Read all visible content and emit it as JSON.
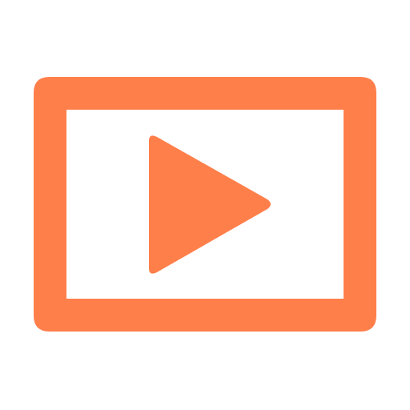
{
  "icon": {
    "name": "video-play-icon",
    "color": "#FF7F4B",
    "background": "#FFFFFF"
  }
}
